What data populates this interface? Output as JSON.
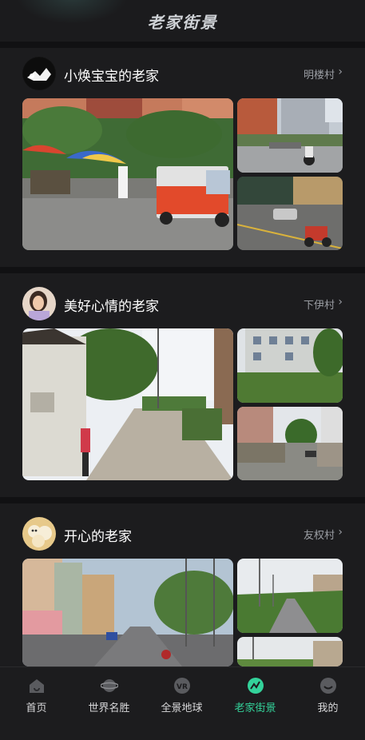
{
  "header": {
    "title": "老家街景"
  },
  "colors": {
    "accent": "#33d29a",
    "background": "#1c1c1e",
    "muted": "#9b9ea4"
  },
  "sections": [
    {
      "title": "小焕宝宝的老家",
      "village": "明楼村",
      "chevron": "›"
    },
    {
      "title": "美好心情的老家",
      "village": "下伊村",
      "chevron": "›"
    },
    {
      "title": "开心的老家",
      "village": "友权村",
      "chevron": "›"
    }
  ],
  "tabs": [
    {
      "label": "首页",
      "icon": "home-icon"
    },
    {
      "label": "世界名胜",
      "icon": "planet-icon"
    },
    {
      "label": "全景地球",
      "icon": "vr-icon"
    },
    {
      "label": "老家街景",
      "icon": "street-icon",
      "active": true
    },
    {
      "label": "我的",
      "icon": "profile-icon"
    }
  ]
}
